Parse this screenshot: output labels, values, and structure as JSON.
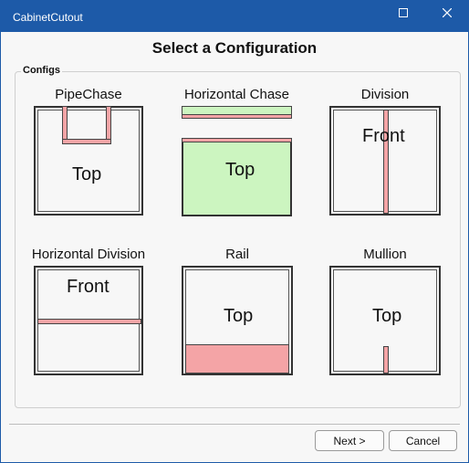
{
  "window": {
    "title": "CabinetCutout"
  },
  "heading": "Select a Configuration",
  "group_label": "Configs",
  "configs": [
    {
      "label": "PipeChase",
      "view": "Top"
    },
    {
      "label": "Horizontal Chase",
      "view": "Top"
    },
    {
      "label": "Division",
      "view": "Front"
    },
    {
      "label": "Horizontal Division",
      "view": "Front"
    },
    {
      "label": "Rail",
      "view": "Top"
    },
    {
      "label": "Mullion",
      "view": "Top"
    }
  ],
  "buttons": {
    "next": "Next >",
    "cancel": "Cancel"
  },
  "colors": {
    "titlebar": "#1d5aa8",
    "cutout_pink": "#f4a4a6",
    "chase_green": "#ccf5c0"
  }
}
